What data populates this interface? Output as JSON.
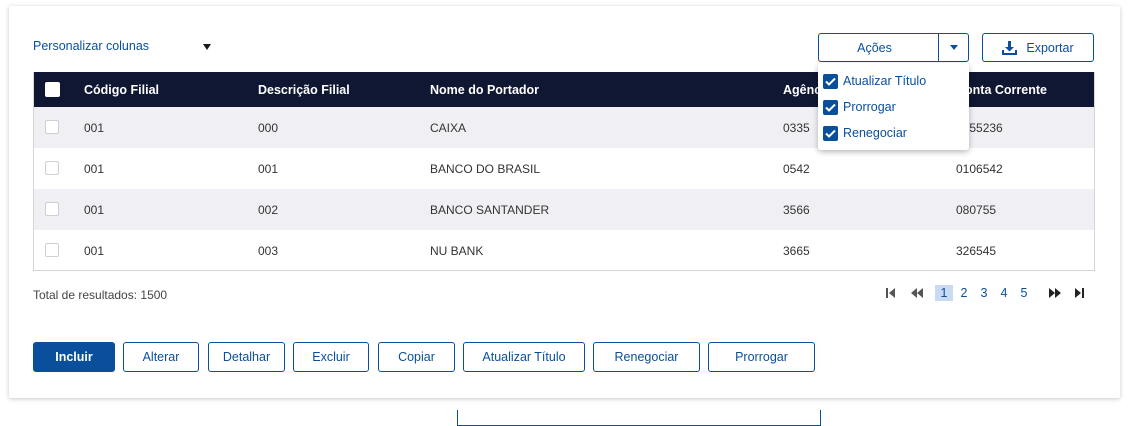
{
  "toolbar": {
    "personalize_label": "Personalizar colunas",
    "actions_label": "Ações",
    "export_label": "Exportar"
  },
  "table": {
    "columns": [
      "Código Filial",
      "Descrição Filial",
      "Nome do Portador",
      "Agência",
      "Conta Corrente"
    ],
    "rows": [
      {
        "codigo": "001",
        "descricao": "000",
        "portador": "CAIXA",
        "agencia": "0335",
        "conta": "0155236"
      },
      {
        "codigo": "001",
        "descricao": "001",
        "portador": "BANCO DO BRASIL",
        "agencia": "0542",
        "conta": "0106542"
      },
      {
        "codigo": "001",
        "descricao": "002",
        "portador": "BANCO SANTANDER",
        "agencia": "3566",
        "conta": "080755"
      },
      {
        "codigo": "001",
        "descricao": "003",
        "portador": "NU BANK",
        "agencia": "3665",
        "conta": "326545"
      }
    ]
  },
  "actions_menu": {
    "items": [
      {
        "label": "Atualizar Título",
        "checked": true
      },
      {
        "label": "Prorrogar",
        "checked": true
      },
      {
        "label": "Renegociar",
        "checked": true
      }
    ]
  },
  "footer": {
    "total_label": "Total de resultados: 1500"
  },
  "pagination": {
    "pages": [
      "1",
      "2",
      "3",
      "4",
      "5"
    ],
    "current": "1"
  },
  "buttons": {
    "incluir": "Incluir",
    "alterar": "Alterar",
    "detalhar": "Detalhar",
    "excluir": "Excluir",
    "copiar": "Copiar",
    "atualizar": "Atualizar Título",
    "renegociar": "Renegociar",
    "prorrogar": "Prorrogar"
  },
  "colors": {
    "primary": "#0a4f9c",
    "header_bg": "#0f1733",
    "row_alt": "#f0f0f4"
  }
}
